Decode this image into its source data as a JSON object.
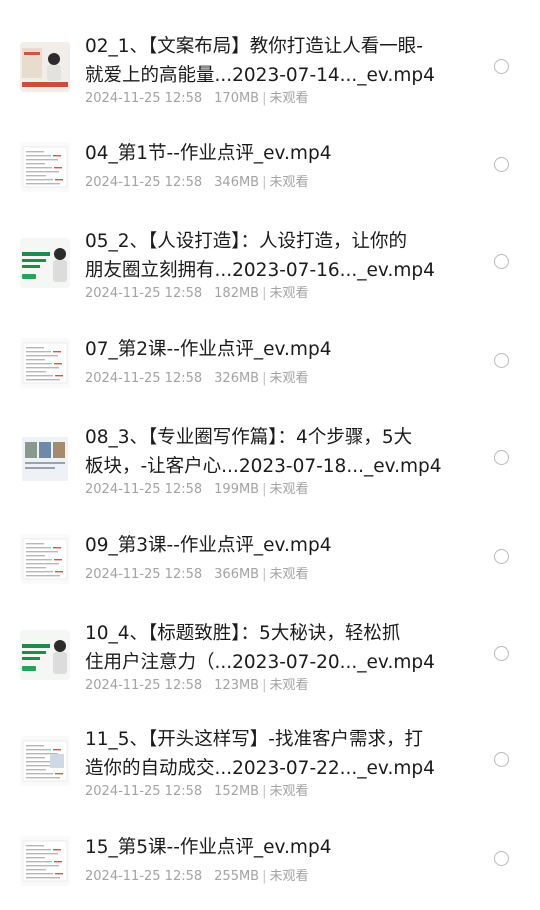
{
  "files": [
    {
      "title_lines": [
        "02_1、【文案布局】教你打造让人看一眼-",
        "就爱上的高能量...2023-07-14..._ev.mp4"
      ],
      "date": "2024-11-25 12:58",
      "size": "170MB",
      "status": "未观看",
      "thumb": "promo-woman"
    },
    {
      "title_lines": [
        "04_第1节--作业点评_ev.mp4"
      ],
      "date": "2024-11-25 12:58",
      "size": "346MB",
      "status": "未观看",
      "thumb": "document"
    },
    {
      "title_lines": [
        "05_2、【人设打造】：人设打造，让你的",
        "朋友圈立刻拥有...2023-07-16..._ev.mp4"
      ],
      "date": "2024-11-25 12:58",
      "size": "182MB",
      "status": "未观看",
      "thumb": "promo-green"
    },
    {
      "title_lines": [
        "07_第2课--作业点评_ev.mp4"
      ],
      "date": "2024-11-25 12:58",
      "size": "326MB",
      "status": "未观看",
      "thumb": "document"
    },
    {
      "title_lines": [
        "08_3、【专业圈写作篇】：4个步骤，5大",
        "板块，-让客户心...2023-07-18..._ev.mp4"
      ],
      "date": "2024-11-25 12:58",
      "size": "199MB",
      "status": "未观看",
      "thumb": "slides"
    },
    {
      "title_lines": [
        "09_第3课--作业点评_ev.mp4"
      ],
      "date": "2024-11-25 12:58",
      "size": "366MB",
      "status": "未观看",
      "thumb": "document"
    },
    {
      "title_lines": [
        "10_4、【标题致胜】：5大秘诀，轻松抓",
        "住用户注意力（...2023-07-20..._ev.mp4"
      ],
      "date": "2024-11-25 12:58",
      "size": "123MB",
      "status": "未观看",
      "thumb": "promo-green"
    },
    {
      "title_lines": [
        "11_5、【开头这样写】-找准客户需求，打",
        "造你的自动成交...2023-07-22..._ev.mp4"
      ],
      "date": "2024-11-25 12:58",
      "size": "152MB",
      "status": "未观看",
      "thumb": "slides-light"
    },
    {
      "title_lines": [
        "15_第5课--作业点评_ev.mp4"
      ],
      "date": "2024-11-25 12:58",
      "size": "255MB",
      "status": "未观看",
      "thumb": "document"
    }
  ],
  "meta_separator": "|",
  "colors": {
    "title": "#1b1b1b",
    "meta": "#a3a3a3",
    "radio_border": "#b9b9b9",
    "promo_green": "#1f8a4c"
  }
}
